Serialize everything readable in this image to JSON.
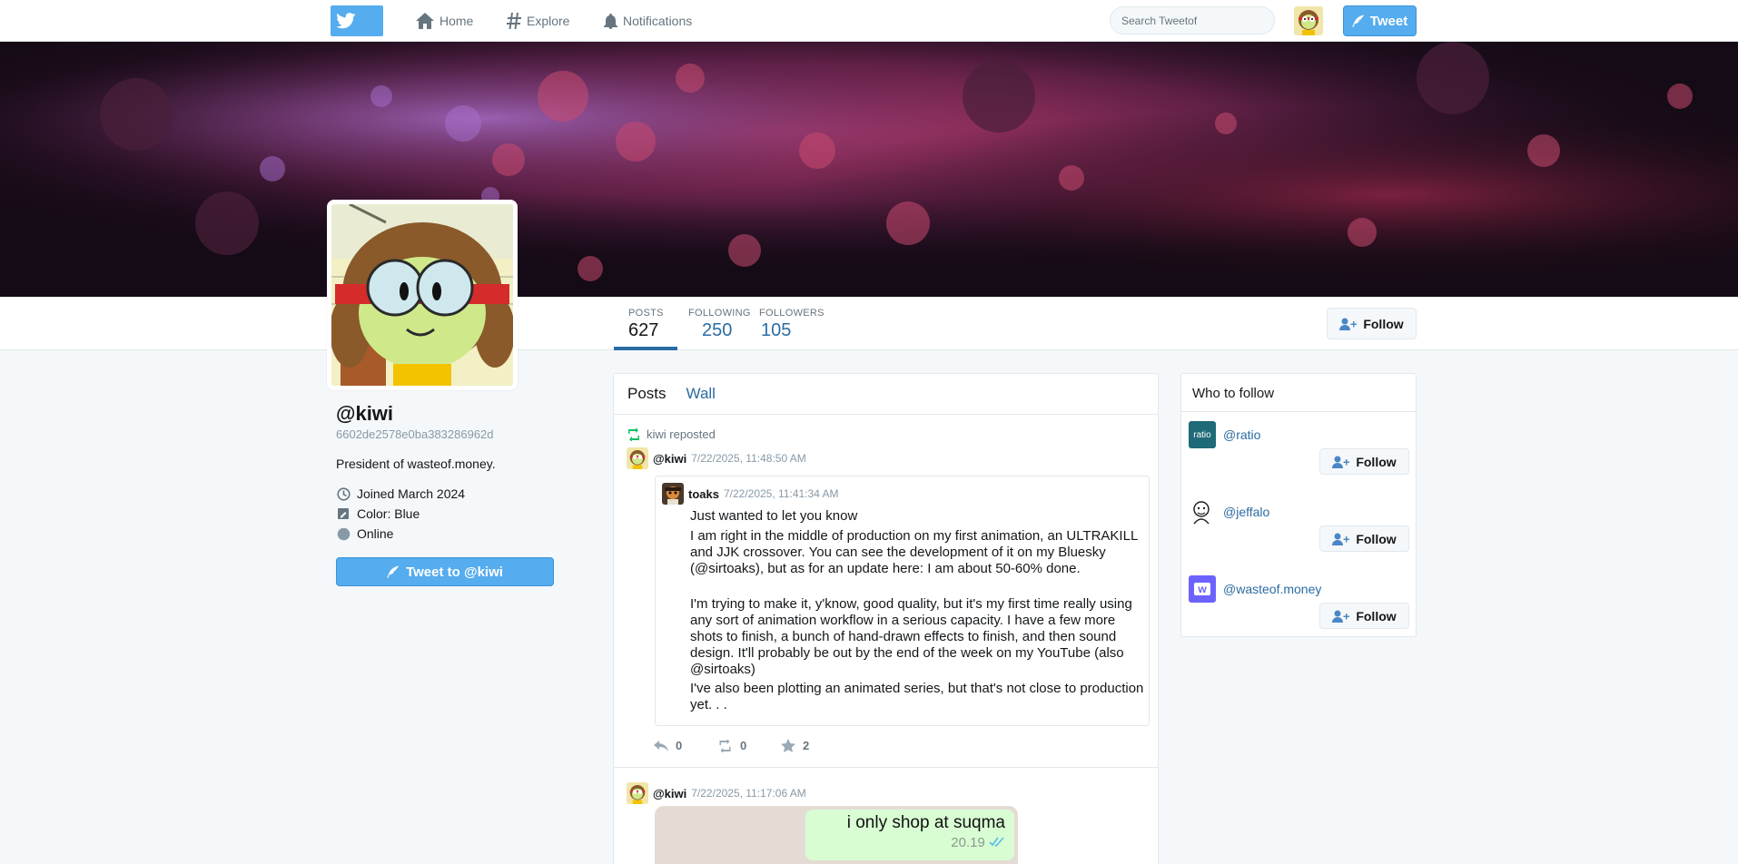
{
  "nav": {
    "home_label": "Home",
    "explore_label": "Explore",
    "notifications_label": "Notifications",
    "search_placeholder": "Search Tweetof",
    "tweet_label": "Tweet"
  },
  "profile": {
    "username": "@kiwi",
    "user_id": "6602de2578e0ba383286962d",
    "bio": "President of wasteof.money.",
    "joined": "Joined March 2024",
    "color": "Color: Blue",
    "status": "Online",
    "tweet_to_label": "Tweet to @kiwi",
    "follow_label": "Follow"
  },
  "stats": [
    {
      "label": "POSTS",
      "value": "627"
    },
    {
      "label": "FOLLOWING",
      "value": "250"
    },
    {
      "label": "FOLLOWERS",
      "value": "105"
    }
  ],
  "timeline": {
    "tabs": [
      "Posts",
      "Wall"
    ],
    "repost_label": "kiwi reposted",
    "post1": {
      "author": "@kiwi",
      "time": "7/22/2025, 11:48:50 AM",
      "quoted_author": "toaks",
      "quoted_time": "7/22/2025, 11:41:34 AM",
      "paragraphs": [
        "Just wanted to let you know",
        "I am right in the middle of production on my first animation, an ULTRAKILL and JJK crossover. You can see the development of it on my Bluesky (@sirtoaks), but as for an update here: I am about 50-60% done.",
        "I'm trying to make it, y'know, good quality, but it's my first time really using any sort of animation workflow in a serious capacity. I have a few more shots to finish, a bunch of hand-drawn effects to finish, and then sound design. It'll probably be out by the end of the week on my YouTube (also @sirtoaks)",
        "I've also been plotting an animated series, but that's not close to production yet. . ."
      ],
      "replies": "0",
      "reposts": "0",
      "likes": "2"
    },
    "post2": {
      "author": "@kiwi",
      "time": "7/22/2025, 11:17:06 AM",
      "image_message": "i only shop at suqma",
      "image_time": "20.19"
    }
  },
  "who_to_follow": {
    "title": "Who to follow",
    "users": [
      {
        "handle": "@ratio",
        "avatar_text": "ratio"
      },
      {
        "handle": "@jeffalo"
      },
      {
        "handle": "@wasteof.money",
        "avatar_text": "w"
      }
    ],
    "follow_label": "Follow"
  },
  "colors": {
    "accent": "#55acee",
    "link": "#2b6ca3"
  }
}
